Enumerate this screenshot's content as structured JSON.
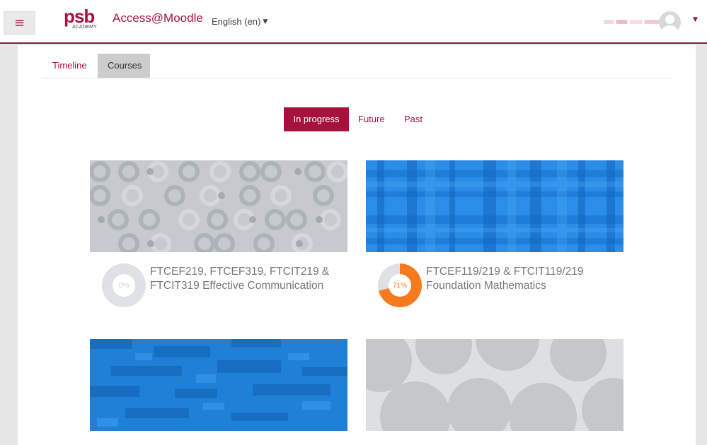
{
  "header": {
    "menu_icon": "hamburger-icon",
    "logo_text": "psb",
    "logo_subtext": "ACADEMY",
    "site_name": "Access@Moodle",
    "language": "English (en)",
    "user_menu_icon": "user-avatar-icon"
  },
  "tabs": [
    {
      "label": "Timeline",
      "active": false
    },
    {
      "label": "Courses",
      "active": true
    }
  ],
  "filters": [
    {
      "label": "In progress",
      "active": true
    },
    {
      "label": "Future",
      "active": false
    },
    {
      "label": "Past",
      "active": false
    }
  ],
  "courses": [
    {
      "name": "FTCEF219, FTCEF319, FTCIT219 & FTCIT319 Effective Communication",
      "progress": 0,
      "progress_label": "0%",
      "image_style": "grey circles pattern"
    },
    {
      "name": "FTCEF119/219 & FTCIT119/219 Foundation Mathematics",
      "progress": 71,
      "progress_label": "71%",
      "image_style": "blue plaid pattern"
    },
    {
      "name": "",
      "progress": null,
      "progress_label": "",
      "image_style": "blue mosaic pattern"
    },
    {
      "name": "",
      "progress": null,
      "progress_label": "",
      "image_style": "grey overlapping circles pattern"
    }
  ],
  "colors": {
    "brand": "#a6123c",
    "progress": "#f77a1f",
    "tab_active_bg": "#cccccc"
  }
}
